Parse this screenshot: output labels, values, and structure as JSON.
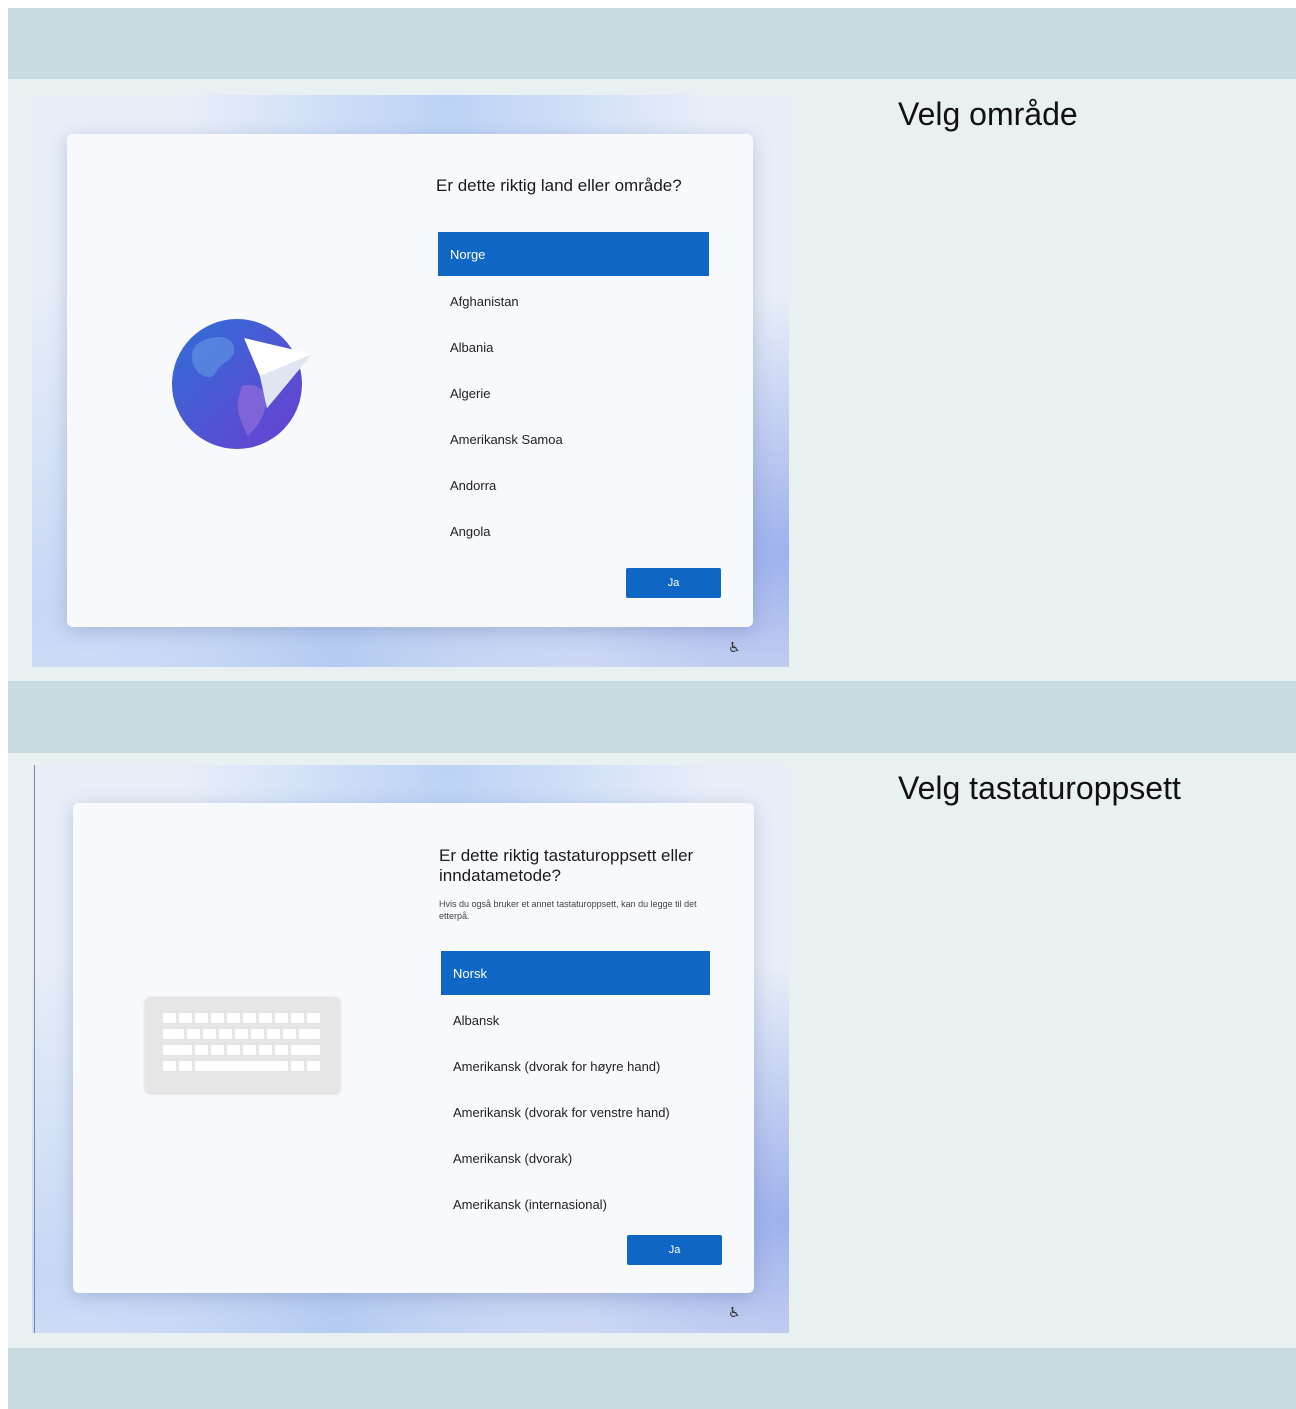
{
  "sections": {
    "region": {
      "heading": "Velg område",
      "question": "Er dette riktig land eller område?",
      "items": [
        "Norge",
        "Afghanistan",
        "Albania",
        "Algerie",
        "Amerikansk Samoa",
        "Andorra",
        "Angola"
      ],
      "button": "Ja",
      "icon": "globe-with-paper-plane-icon"
    },
    "keyboard": {
      "heading": "Velg tastaturoppsett",
      "question": "Er dette riktig tastaturoppsett eller inndatametode?",
      "subtitle": "Hvis du også bruker et annet tastaturoppsett, kan du legge til det etterpå.",
      "items": [
        "Norsk",
        "Albansk",
        "Amerikansk (dvorak for høyre hand)",
        "Amerikansk (dvorak for venstre hand)",
        "Amerikansk (dvorak)",
        "Amerikansk (internasional)"
      ],
      "button": "Ja",
      "icon": "keyboard-icon"
    }
  },
  "accessibility_icon": "accessibility-icon",
  "colors": {
    "accent": "#0f66c4",
    "band": "#c9dbe0",
    "section_bg": "#e9f0f2"
  }
}
